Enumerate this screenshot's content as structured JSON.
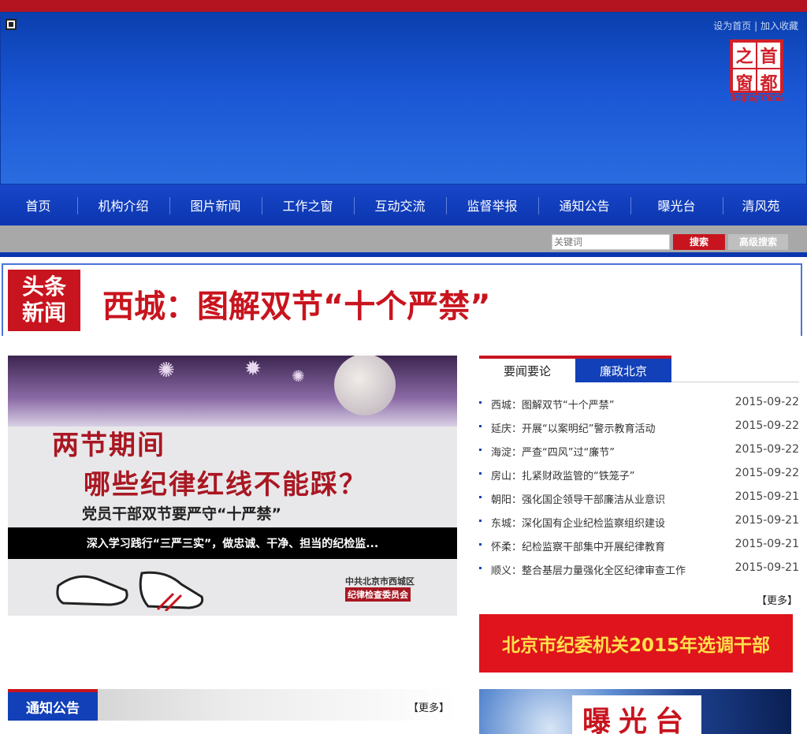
{
  "top_links": {
    "home": "设为首页",
    "sep": " | ",
    "fav": "加入收藏"
  },
  "logo": {
    "chars": [
      "首",
      "之",
      "都",
      "窗"
    ],
    "sub": "Beijing China"
  },
  "nav": [
    "首页",
    "机构介绍",
    "图片新闻",
    "工作之窗",
    "互动交流",
    "监督举报",
    "通知公告",
    "曝光台",
    "清风苑"
  ],
  "search": {
    "placeholder": "关键词",
    "button": "搜索",
    "advanced": "高级搜索"
  },
  "headline": {
    "badge_l1": "头条",
    "badge_l2": "新闻",
    "title": "西城：图解双节“十个严禁”"
  },
  "slide": {
    "line1": "两节期间",
    "line2": "哪些纪律红线不能踩？",
    "line3": "党员干部双节要严守“十严禁”",
    "caption": "深入学习践行“三严三实”，做忠诚、干净、担当的纪检监...",
    "org1": "中共北京市西城区",
    "org2": "纪律检查委员会"
  },
  "tabs": [
    "要闻要论",
    "廉政北京"
  ],
  "news": [
    {
      "title": "西城：图解双节“十个严禁”",
      "date": "2015-09-22"
    },
    {
      "title": "延庆：开展“以案明纪”警示教育活动",
      "date": "2015-09-22"
    },
    {
      "title": "海淀：严查“四风”过“廉节”",
      "date": "2015-09-22"
    },
    {
      "title": "房山：扎紧财政监管的“铁笼子”",
      "date": "2015-09-22"
    },
    {
      "title": "朝阳：强化国企领导干部廉洁从业意识",
      "date": "2015-09-21"
    },
    {
      "title": "东城：深化国有企业纪检监察组织建设",
      "date": "2015-09-21"
    },
    {
      "title": "怀柔：纪检监察干部集中开展纪律教育",
      "date": "2015-09-21"
    },
    {
      "title": "顺义：整合基层力量强化全区纪律审查工作",
      "date": "2015-09-21"
    }
  ],
  "news_more": "【更多】",
  "ad1": "北京市纪委机关2015年选调干部",
  "notice": {
    "title": "通知公告",
    "more": "【更多】"
  },
  "ad2": "曝光台",
  "colors": {
    "brand_red": "#c8141e",
    "brand_blue": "#1140b8"
  }
}
